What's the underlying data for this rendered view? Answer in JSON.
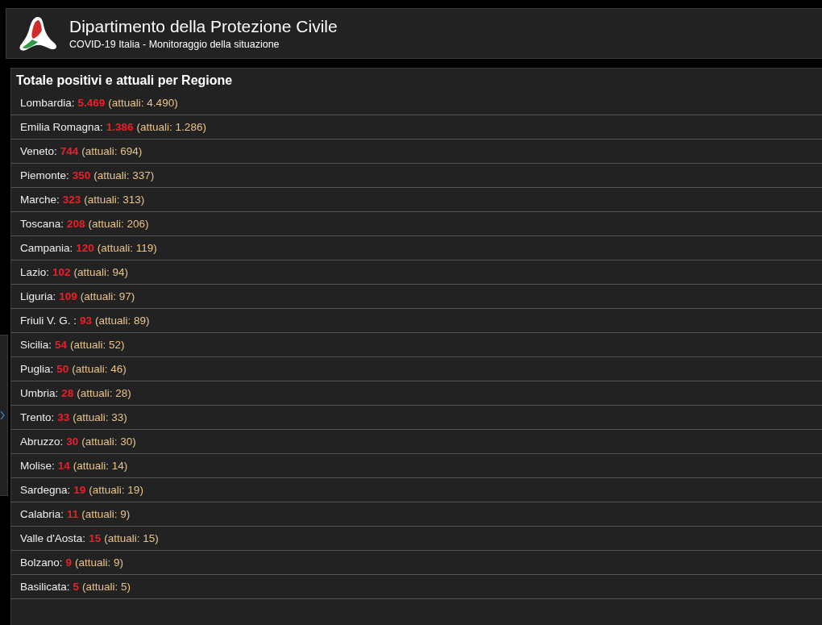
{
  "header": {
    "title": "Dipartimento della Protezione Civile",
    "subtitle": "COVID-19 Italia - Monitoraggio della situazione"
  },
  "panel": {
    "title": "Totale positivi e attuali per Regione",
    "rows": [
      {
        "region": "Lombardia:",
        "total": "5.469",
        "current": "(attuali: 4.490)"
      },
      {
        "region": "Emilia Romagna:",
        "total": "1.386",
        "current": "(attuali: 1.286)"
      },
      {
        "region": "Veneto:",
        "total": "744",
        "current": "(attuali: 694)"
      },
      {
        "region": "Piemonte:",
        "total": "350",
        "current": "(attuali: 337)"
      },
      {
        "region": "Marche:",
        "total": "323",
        "current": "(attuali: 313)"
      },
      {
        "region": "Toscana:",
        "total": "208",
        "current": "(attuali: 206)"
      },
      {
        "region": "Campania:",
        "total": "120",
        "current": "(attuali: 119)"
      },
      {
        "region": "Lazio:",
        "total": "102",
        "current": "(attuali: 94)"
      },
      {
        "region": "Liguria:",
        "total": "109",
        "current": "(attuali: 97)"
      },
      {
        "region": "Friuli V. G. :",
        "total": "93",
        "current": "(attuali: 89)"
      },
      {
        "region": "Sicilia:",
        "total": "54",
        "current": "(attuali: 52)"
      },
      {
        "region": "Puglia:",
        "total": "50",
        "current": "(attuali: 46)"
      },
      {
        "region": "Umbria:",
        "total": "28",
        "current": "(attuali: 28)"
      },
      {
        "region": "Trento:",
        "total": "33",
        "current": "(attuali: 33)"
      },
      {
        "region": "Abruzzo:",
        "total": "30",
        "current": "(attuali: 30)"
      },
      {
        "region": "Molise:",
        "total": "14",
        "current": "(attuali: 14)"
      },
      {
        "region": "Sardegna:",
        "total": "19",
        "current": "(attuali: 19)"
      },
      {
        "region": "Calabria:",
        "total": "11",
        "current": "(attuali: 9)"
      },
      {
        "region": "Valle d'Aosta:",
        "total": "15",
        "current": "(attuali: 15)"
      },
      {
        "region": "Bolzano:",
        "total": "9",
        "current": "(attuali: 9)"
      },
      {
        "region": "Basilicata:",
        "total": "5",
        "current": "(attuali: 5)"
      }
    ]
  }
}
